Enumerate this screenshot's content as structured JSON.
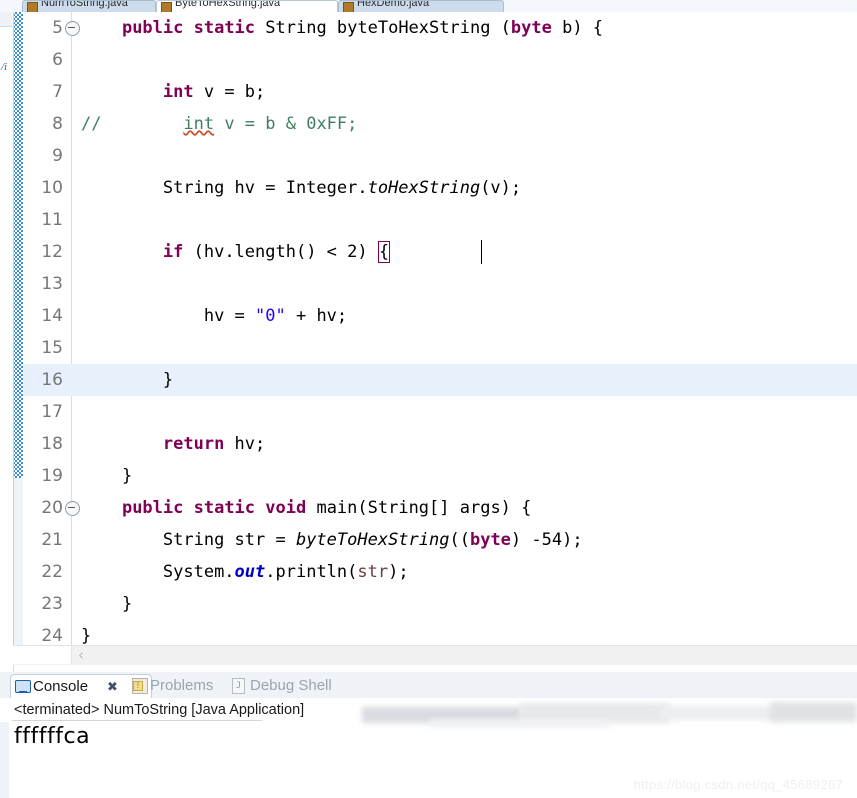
{
  "window": {
    "tabstrip": [
      {
        "label": "NumToString.java",
        "active": false,
        "icon": "java-file-icon"
      },
      {
        "label": "ByteToHexString.java",
        "active": true,
        "icon": "java-file-icon"
      },
      {
        "label": "HexDemo.java",
        "active": false,
        "icon": "java-file-icon"
      }
    ],
    "left_strip_icon": "outline-view-icon"
  },
  "editor": {
    "name": "java-source-editor",
    "highlighted_line": 16,
    "lines": [
      {
        "num": "5",
        "fold": true,
        "indent": 4,
        "tokens": [
          {
            "t": "public ",
            "c": "kw"
          },
          {
            "t": "static ",
            "c": "kw"
          },
          {
            "t": "String byteToHexString (",
            "c": ""
          },
          {
            "t": "byte",
            "c": "kw"
          },
          {
            "t": " b) {",
            "c": ""
          }
        ]
      },
      {
        "num": "6",
        "fold": false,
        "indent": 0,
        "tokens": []
      },
      {
        "num": "7",
        "fold": false,
        "indent": 8,
        "tokens": [
          {
            "t": "int",
            "c": "kw"
          },
          {
            "t": " v = b;",
            "c": ""
          }
        ]
      },
      {
        "num": "8",
        "fold": false,
        "indent": 0,
        "tokens": [
          {
            "t": "//",
            "c": "cmt"
          },
          {
            "t": "        ",
            "c": "cmt"
          },
          {
            "t": "int",
            "c": "cmt sq"
          },
          {
            "t": " v = b & 0xFF;",
            "c": "cmt"
          }
        ]
      },
      {
        "num": "9",
        "fold": false,
        "indent": 0,
        "tokens": []
      },
      {
        "num": "10",
        "fold": false,
        "indent": 8,
        "tokens": [
          {
            "t": "String hv = Integer.",
            "c": ""
          },
          {
            "t": "toHexString",
            "c": "stm"
          },
          {
            "t": "(v);",
            "c": ""
          }
        ]
      },
      {
        "num": "11",
        "fold": false,
        "indent": 0,
        "tokens": []
      },
      {
        "num": "12",
        "fold": false,
        "indent": 8,
        "tokens": [
          {
            "t": "if",
            "c": "kw"
          },
          {
            "t": " (hv.length() < 2) ",
            "c": ""
          },
          {
            "t": "{",
            "c": "bracketbox"
          }
        ]
      },
      {
        "num": "13",
        "fold": false,
        "indent": 0,
        "tokens": []
      },
      {
        "num": "14",
        "fold": false,
        "indent": 12,
        "tokens": [
          {
            "t": "hv = ",
            "c": ""
          },
          {
            "t": "\"0\"",
            "c": "str"
          },
          {
            "t": " + hv;",
            "c": ""
          }
        ]
      },
      {
        "num": "15",
        "fold": false,
        "indent": 0,
        "tokens": []
      },
      {
        "num": "16",
        "fold": false,
        "indent": 8,
        "tokens": [
          {
            "t": "}",
            "c": ""
          }
        ]
      },
      {
        "num": "17",
        "fold": false,
        "indent": 0,
        "tokens": []
      },
      {
        "num": "18",
        "fold": false,
        "indent": 8,
        "tokens": [
          {
            "t": "return",
            "c": "kw"
          },
          {
            "t": " hv;",
            "c": ""
          }
        ]
      },
      {
        "num": "19",
        "fold": false,
        "indent": 4,
        "tokens": [
          {
            "t": "}",
            "c": ""
          }
        ]
      },
      {
        "num": "20",
        "fold": true,
        "indent": 4,
        "tokens": [
          {
            "t": "public ",
            "c": "kw"
          },
          {
            "t": "static ",
            "c": "kw"
          },
          {
            "t": "void",
            "c": "kw"
          },
          {
            "t": " main(String[] args) {",
            "c": ""
          }
        ]
      },
      {
        "num": "21",
        "fold": false,
        "indent": 8,
        "tokens": [
          {
            "t": "String str = ",
            "c": ""
          },
          {
            "t": "byteToHexString",
            "c": "stm"
          },
          {
            "t": "((",
            "c": ""
          },
          {
            "t": "byte",
            "c": "kw"
          },
          {
            "t": ") -54);",
            "c": ""
          }
        ]
      },
      {
        "num": "22",
        "fold": false,
        "indent": 8,
        "tokens": [
          {
            "t": "System.",
            "c": ""
          },
          {
            "t": "out",
            "c": "fld"
          },
          {
            "t": ".println(",
            "c": ""
          },
          {
            "t": "str",
            "c": "loc"
          },
          {
            "t": ");",
            "c": ""
          }
        ]
      },
      {
        "num": "23",
        "fold": false,
        "indent": 4,
        "tokens": [
          {
            "t": "}",
            "c": ""
          }
        ]
      },
      {
        "num": "24",
        "fold": false,
        "indent": 0,
        "tokens": [
          {
            "t": "}",
            "c": ""
          }
        ]
      }
    ],
    "hscroll_left_arrow": "‹"
  },
  "console": {
    "tabs": [
      {
        "label": "Console",
        "icon": "console-icon",
        "active": true,
        "close": "✖"
      },
      {
        "label": "Problems",
        "icon": "problems-icon",
        "active": false,
        "close": ""
      },
      {
        "label": "Debug Shell",
        "icon": "debug-shell-icon",
        "active": false,
        "close": ""
      }
    ],
    "debug_shell_glyph": "J",
    "launch_line": "<terminated> NumToString [Java Application] ",
    "output": "ffffffca"
  },
  "watermark": "https://blog.csdn.net/qq_45689267",
  "colors": {
    "keyword": "#7f0055",
    "comment": "#3f7f5f",
    "string": "#2a00ff",
    "static_field": "#0000c0",
    "local_var": "#6a3e3e",
    "line_highlight": "#e8f1fb",
    "annotation_ruler": "#3f8fd0"
  }
}
